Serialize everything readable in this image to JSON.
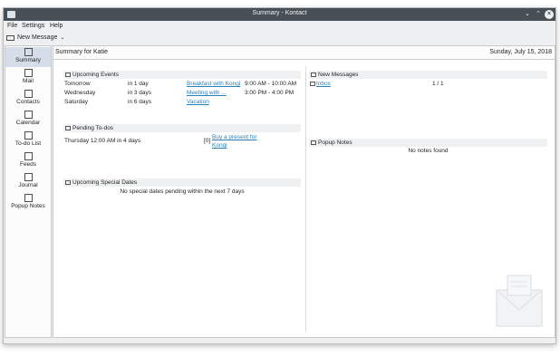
{
  "window": {
    "title": "Summary - Kontact"
  },
  "menubar": {
    "items": [
      "File",
      "Settings",
      "Help"
    ]
  },
  "toolbar": {
    "new_message": "New Message"
  },
  "sidebar": {
    "items": [
      {
        "label": "Summary",
        "icon": "summary-icon",
        "active": true
      },
      {
        "label": "Mail",
        "icon": "mail-icon"
      },
      {
        "label": "Contacts",
        "icon": "contacts-icon"
      },
      {
        "label": "Calendar",
        "icon": "calendar-icon"
      },
      {
        "label": "To-do List",
        "icon": "todo-icon"
      },
      {
        "label": "Feeds",
        "icon": "feeds-icon"
      },
      {
        "label": "Journal",
        "icon": "journal-icon"
      },
      {
        "label": "Popup Notes",
        "icon": "popup-notes-icon"
      }
    ]
  },
  "summary": {
    "heading": "Summary for Katie",
    "date": "Sunday, July 15, 2018"
  },
  "events": {
    "title": "Upcoming Events",
    "rows": [
      {
        "day": "Tomorrow",
        "when": "in 1 day",
        "summary": "Breakfast with Kongi",
        "time": "9:00 AM - 10:00 AM"
      },
      {
        "day": "Wednesday",
        "when": "in 3 days",
        "summary": "Meeting with ...",
        "time": "3:00 PM - 4:00 PM"
      },
      {
        "day": "Saturday",
        "when": "in 6 days",
        "summary": "Vacation",
        "time": ""
      }
    ]
  },
  "todos": {
    "title": "Pending To-dos",
    "rows": [
      {
        "due": "Thursday 12:00 AM in 4 days",
        "priority": "[0]",
        "summary_line1": "Buy a present for",
        "summary_line2": "Kongi"
      }
    ]
  },
  "special_dates": {
    "title": "Upcoming Special Dates",
    "empty": "No special dates pending within the next 7 days"
  },
  "messages": {
    "title": "New Messages",
    "rows": [
      {
        "folder": "Inbox",
        "count": "1 / 1"
      }
    ]
  },
  "popup_notes": {
    "title": "Popup Notes",
    "empty": "No notes found"
  },
  "colors": {
    "titlebar": "#475057",
    "link": "#2980b9",
    "selection": "#d5dde8"
  }
}
